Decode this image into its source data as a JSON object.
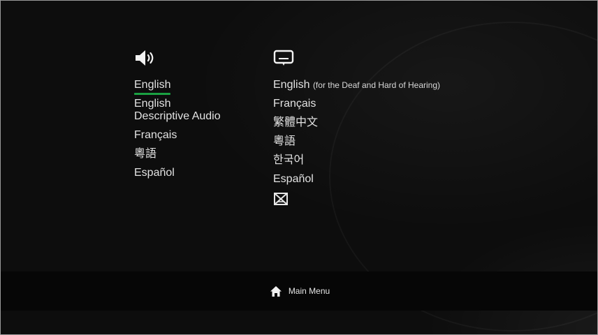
{
  "audio": {
    "icon": "speaker-icon",
    "items": [
      {
        "label": "English",
        "selected": true
      },
      {
        "label": "English"
      },
      {
        "label": "Descriptive Audio"
      },
      {
        "label": "Français"
      },
      {
        "label": "粵語"
      },
      {
        "label": "Español"
      }
    ]
  },
  "subtitles": {
    "icon": "subtitles-icon",
    "items": [
      {
        "label": "English",
        "note": "(for the Deaf and Hard of Hearing)"
      },
      {
        "label": "Français"
      },
      {
        "label": "繁體中文"
      },
      {
        "label": "粵語"
      },
      {
        "label": "한국어"
      },
      {
        "label": "Español"
      }
    ],
    "off_icon": "subtitles-off-icon"
  },
  "footer": {
    "icon": "home-icon",
    "main_menu_label": "Main Menu"
  },
  "colors": {
    "selection_underline": "#1aa142",
    "text": "#e2e2e2",
    "background": "#0d0d0d"
  }
}
